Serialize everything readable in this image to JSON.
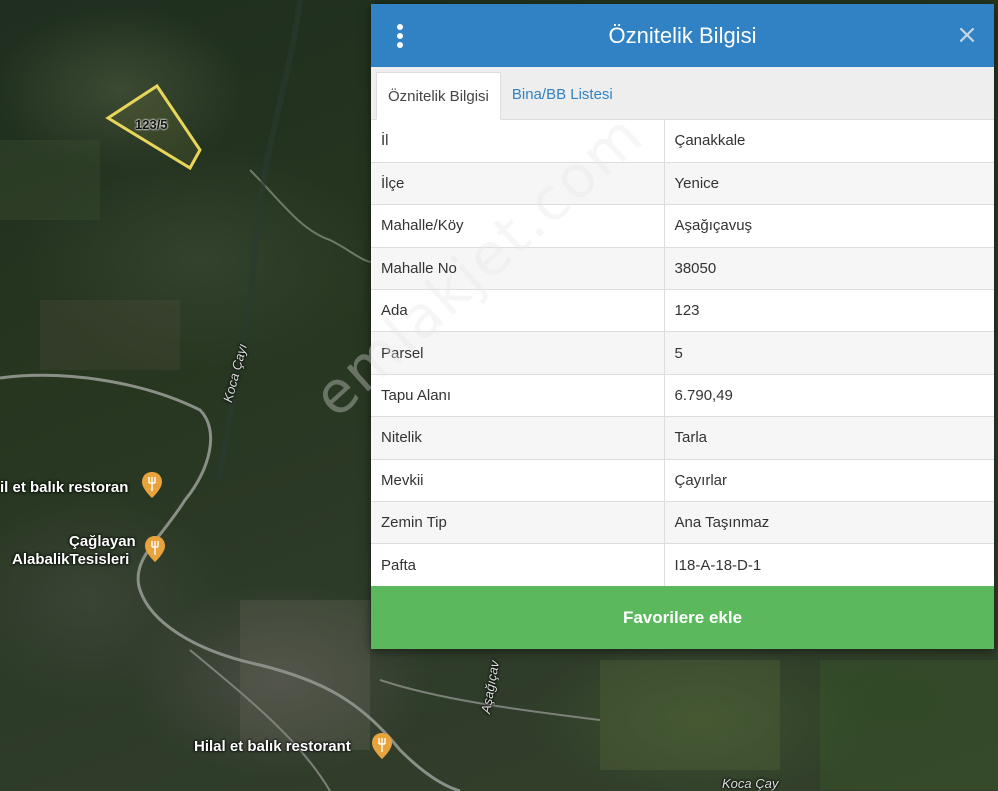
{
  "map": {
    "parcel_label": "123/5",
    "labels": [
      {
        "id": "restoran-1",
        "text": "il et balık restoran"
      },
      {
        "id": "caglayan-1",
        "text": "Çağlayan"
      },
      {
        "id": "caglayan-2",
        "text": "AlabalikTesisleri"
      },
      {
        "id": "hilal",
        "text": "Hilal et balık restorant"
      },
      {
        "id": "koca-cayi",
        "text": "Koca Çayı"
      },
      {
        "id": "asagicavus",
        "text": "Aşağıçav"
      },
      {
        "id": "koca-bottom",
        "text": "Koca Çay"
      }
    ],
    "watermark": "emlakjet.com"
  },
  "panel": {
    "title": "Öznitelik Bilgisi",
    "menu_icon": "kebab-menu-icon",
    "close_icon": "close-icon",
    "close_glyph": "×",
    "tabs": [
      {
        "label": "Öznitelik Bilgisi",
        "active": true
      },
      {
        "label": "Bina/BB Listesi",
        "active": false
      }
    ],
    "rows": [
      {
        "key": "İl",
        "value": "Çanakkale"
      },
      {
        "key": "İlçe",
        "value": "Yenice"
      },
      {
        "key": "Mahalle/Köy",
        "value": "Aşağıçavuş"
      },
      {
        "key": "Mahalle No",
        "value": "38050"
      },
      {
        "key": "Ada",
        "value": "123"
      },
      {
        "key": "Parsel",
        "value": "5"
      },
      {
        "key": "Tapu Alanı",
        "value": "6.790,49"
      },
      {
        "key": "Nitelik",
        "value": "Tarla"
      },
      {
        "key": "Mevkii",
        "value": "Çayırlar"
      },
      {
        "key": "Zemin Tip",
        "value": "Ana Taşınmaz"
      },
      {
        "key": "Pafta",
        "value": "I18-A-18-D-1"
      }
    ],
    "favorite_button": "Favorilere ekle"
  },
  "colors": {
    "header": "#3182c4",
    "favorite": "#5cb85c",
    "parcel_outline": "#e8d65a",
    "pin": "#e8a33c"
  }
}
